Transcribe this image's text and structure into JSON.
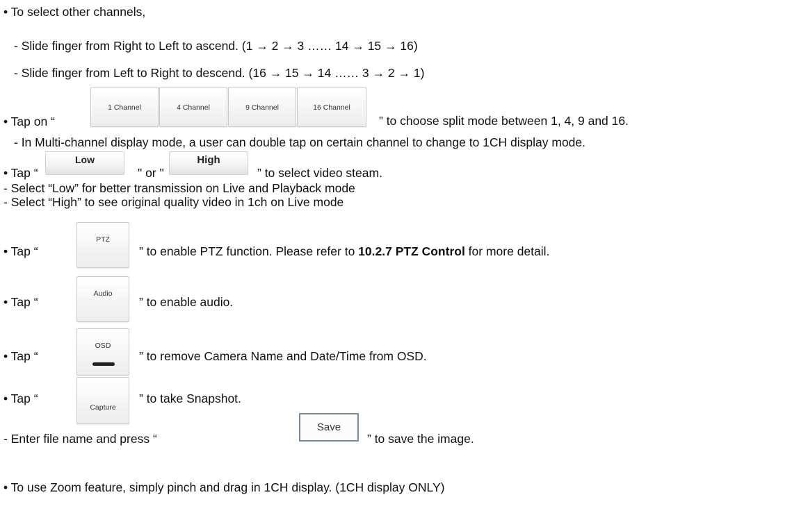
{
  "lines": {
    "l1": "• To select other channels,",
    "l2": "-  Slide finger from Right to Left to ascend. (1  →  2  →  3 …… 14  →  15  →  16)",
    "l3": "-  Slide finger from Left to Right to descend. (16  →  15  →  14 …… 3  →  2  →  1)",
    "l4a": "• Tap on “",
    "l4b": "” to choose split mode between 1, 4, 9 and 16.",
    "l5": "-  In Multi-channel display mode, a user can double tap on certain channel to change to 1CH display mode.",
    "l6a": "• Tap “",
    "l6b": "\" or \"",
    "l6c": "” to select video steam.",
    "l7": "- Select “Low” for better transmission on Live and Playback mode",
    "l8": "- Select “High” to see original quality video in 1ch on Live mode",
    "ptz_a": "• Tap “",
    "ptz_b": "” to enable PTZ function. Please refer to ",
    "ptz_ref": "10.2.7 PTZ Control",
    "ptz_c": " for more detail.",
    "audio_a": "• Tap “",
    "audio_b": "” to enable audio.",
    "osd_a": "• Tap “",
    "osd_b": "” to remove Camera Name and Date/Time from OSD.",
    "cap_a": "• Tap “",
    "cap_b": "” to take Snapshot.",
    "save_a": "-  Enter file name and press “",
    "save_b": "” to save the image.",
    "zoom": "• To use Zoom feature, simply pinch and drag in 1CH display. (1CH display ONLY)"
  },
  "buttons": {
    "ch1": "1 Channel",
    "ch4": "4 Channel",
    "ch9": "9 Channel",
    "ch16": "16 Channel",
    "low": "Low",
    "high": "High",
    "ptz": "PTZ",
    "audio": "Audio",
    "osd": "OSD",
    "capture": "Capture",
    "save": "Save"
  }
}
